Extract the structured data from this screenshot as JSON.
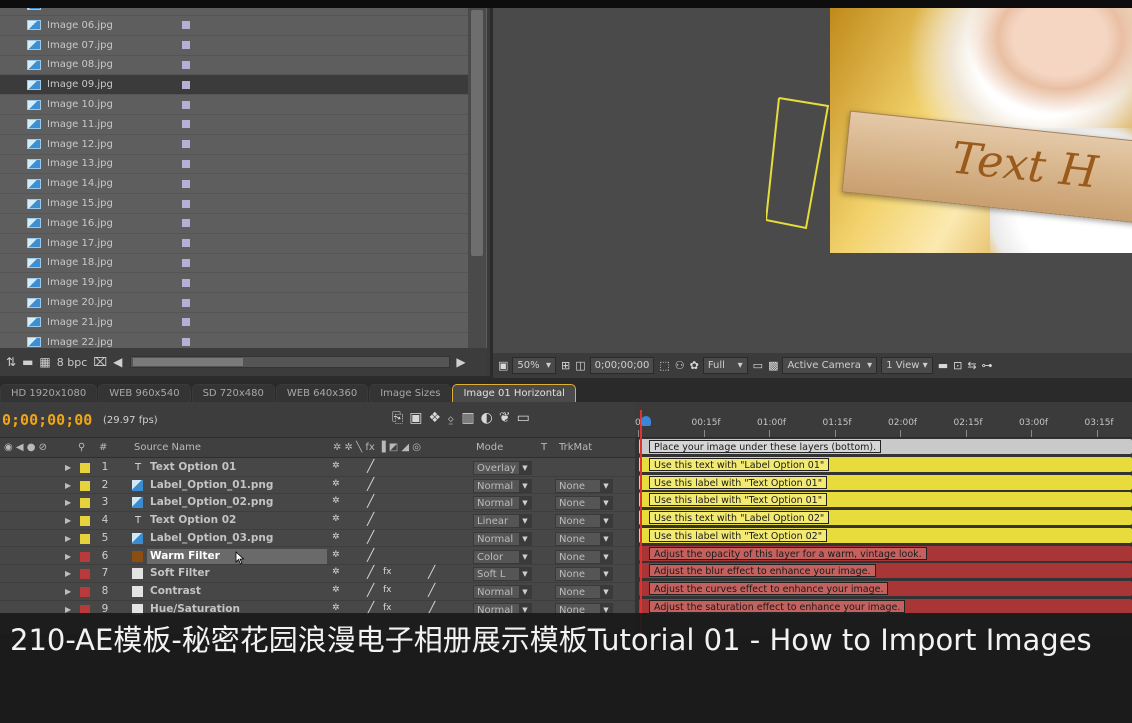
{
  "project_panel": {
    "items": [
      {
        "name": "Image 06.jpg"
      },
      {
        "name": "Image 07.jpg"
      },
      {
        "name": "Image 08.jpg"
      },
      {
        "name": "Image 09.jpg"
      },
      {
        "name": "Image 10.jpg"
      },
      {
        "name": "Image 11.jpg"
      },
      {
        "name": "Image 12.jpg"
      },
      {
        "name": "Image 13.jpg"
      },
      {
        "name": "Image 14.jpg"
      },
      {
        "name": "Image 15.jpg"
      },
      {
        "name": "Image 16.jpg"
      },
      {
        "name": "Image 17.jpg"
      },
      {
        "name": "Image 18.jpg"
      },
      {
        "name": "Image 19.jpg"
      },
      {
        "name": "Image 20.jpg"
      },
      {
        "name": "Image 21.jpg"
      },
      {
        "name": "Image 22.jpg"
      }
    ],
    "selected_index": 3,
    "bit_depth": "8 bpc",
    "swatch_color": "#b5b0d8"
  },
  "viewer": {
    "label_text": "Text H",
    "zoom": "50%",
    "timecode": "0;00;00;00",
    "resolution": "Full",
    "camera": "Active Camera",
    "view": "1 View"
  },
  "tabs": [
    {
      "label": "HD 1920x1080",
      "active": false
    },
    {
      "label": "WEB 960x540",
      "active": false
    },
    {
      "label": "SD 720x480",
      "active": false
    },
    {
      "label": "WEB 640x360",
      "active": false
    },
    {
      "label": "Image Sizes",
      "active": false
    },
    {
      "label": "Image 01 Horizontal",
      "active": true
    }
  ],
  "timeline": {
    "current_time": "0;00;00;00",
    "fps": "(29.97 fps)",
    "columns": {
      "source_name": "Source Name",
      "mode": "Mode",
      "t": "T",
      "trkmat": "TrkMat",
      "num": "#"
    },
    "ruler_ticks": [
      "00f",
      "00:15f",
      "01:00f",
      "01:15f",
      "02:00f",
      "02:15f",
      "03:00f",
      "03:15f"
    ],
    "top_note": "Place your image under these layers (bottom).",
    "layers": [
      {
        "num": "1",
        "name": "Text Option 01",
        "label_color": "#e6d23a",
        "type": "text",
        "mode": "Overlay",
        "trkmat": "",
        "note": "Use this text with \"Label Option 01\"",
        "bar_color": "#e8dc3c"
      },
      {
        "num": "2",
        "name": "Label_Option_01.png",
        "label_color": "#e6d23a",
        "type": "image",
        "mode": "Normal",
        "trkmat": "None",
        "note": "Use this label with \"Text Option 01\"",
        "bar_color": "#e8dc3c"
      },
      {
        "num": "3",
        "name": "Label_Option_02.png",
        "label_color": "#e6d23a",
        "type": "image",
        "mode": "Normal",
        "trkmat": "None",
        "note": "Use this label with \"Text Option 01\"",
        "bar_color": "#e8dc3c"
      },
      {
        "num": "4",
        "name": "Text Option 02",
        "label_color": "#e6d23a",
        "type": "text",
        "mode": "Linear",
        "trkmat": "None",
        "note": "Use this text with \"Label Option 02\"",
        "bar_color": "#e8dc3c"
      },
      {
        "num": "5",
        "name": "Label_Option_03.png",
        "label_color": "#e6d23a",
        "type": "image",
        "mode": "Normal",
        "trkmat": "None",
        "note": "Use this label with \"Text Option 02\"",
        "bar_color": "#e8dc3c"
      },
      {
        "num": "6",
        "name": "Warm Filter",
        "label_color": "#b83a3a",
        "type": "solid-brown",
        "mode": "Color",
        "trkmat": "None",
        "note": "Adjust the opacity of this layer for a warm, vintage look.",
        "bar_color": "#a93636",
        "selected": true
      },
      {
        "num": "7",
        "name": "Soft Filter",
        "label_color": "#b83a3a",
        "type": "adjustment",
        "mode": "Soft L",
        "trkmat": "None",
        "note": "Adjust the blur effect to enhance your image.",
        "bar_color": "#a93636"
      },
      {
        "num": "8",
        "name": "Contrast",
        "label_color": "#b83a3a",
        "type": "adjustment",
        "mode": "Normal",
        "trkmat": "None",
        "note": "Adjust the curves effect to enhance your image.",
        "bar_color": "#a93636"
      },
      {
        "num": "9",
        "name": "Hue/Saturation",
        "label_color": "#b83a3a",
        "type": "adjustment",
        "mode": "Normal",
        "trkmat": "None",
        "note": "Adjust the saturation effect to enhance your image.",
        "bar_color": "#a93636"
      }
    ]
  },
  "subtitle": "210-AE模板-秘密花园浪漫电子相册展示模板Tutorial 01 - How to Import Images",
  "colors": {
    "timecode": "#f1a514",
    "active_tab_border": "#e0b030",
    "yellow_bar": "#e8dc3c",
    "red_bar": "#a93636"
  }
}
